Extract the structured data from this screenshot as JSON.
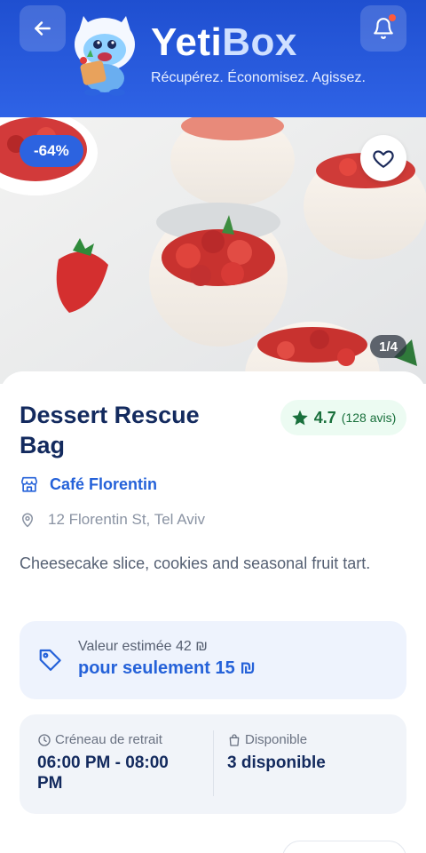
{
  "header": {
    "brand_part1": "Yeti",
    "brand_part2": "Box",
    "tagline": "Récupérez. Économisez. Agissez."
  },
  "hero": {
    "discount": "-64%",
    "image_counter": "1/4"
  },
  "product": {
    "title": "Dessert Rescue Bag",
    "rating_value": "4.7",
    "rating_count": "(128 avis)",
    "shop_name": "Café Florentin",
    "address": "12 Florentin St, Tel Aviv",
    "description": "Cheesecake slice, cookies and seasonal fruit tart."
  },
  "pricing": {
    "estimated_label": "Valeur estimée 42 ₪",
    "price_label": "pour seulement 15 ₪"
  },
  "pickup": {
    "window_label": "Créneau de retrait",
    "window_value": "06:00 PM - 08:00 PM",
    "available_label": "Disponible",
    "available_value": "3 disponible"
  },
  "colors": {
    "brand_blue": "#2562d9",
    "header_blue": "#1f4fd0",
    "rating_green": "#19703c"
  }
}
